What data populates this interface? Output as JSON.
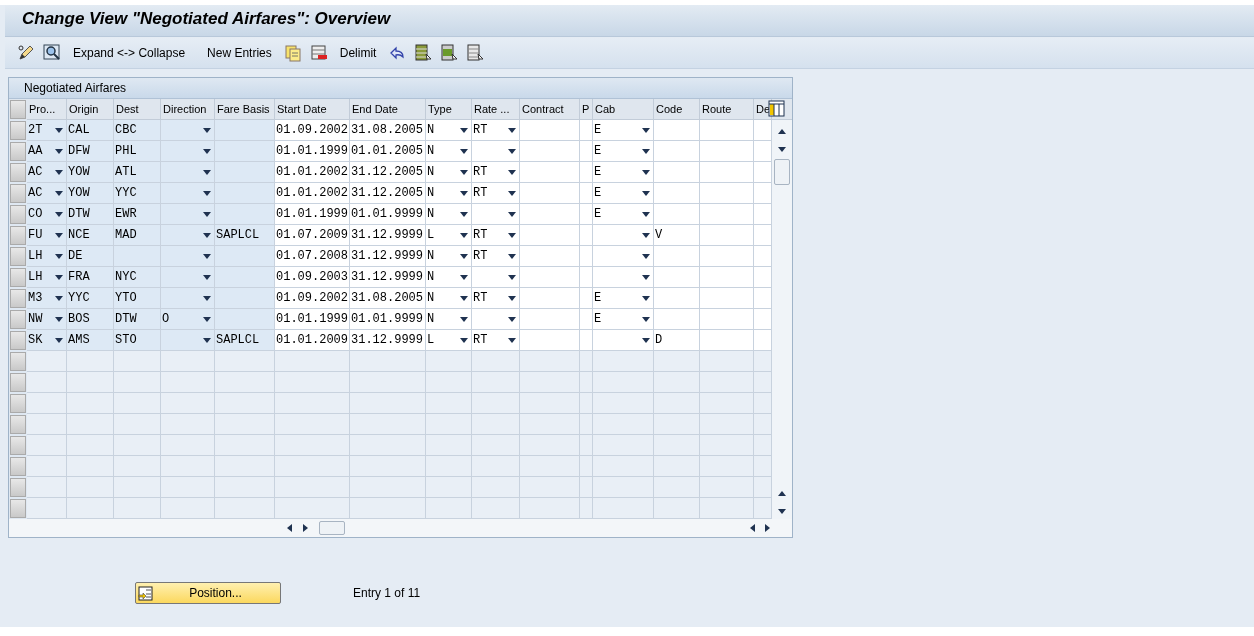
{
  "window": {
    "title": "Change View \"Negotiated Airfares\": Overview"
  },
  "toolbar": {
    "buttons": [
      "Expand <-> Collapse",
      "New Entries",
      "Delimit"
    ]
  },
  "table": {
    "title": "Negotiated Airfares",
    "columns": [
      {
        "label": "Pro...",
        "kind": "keylist"
      },
      {
        "label": "Origin",
        "kind": "key"
      },
      {
        "label": "Dest",
        "kind": "key"
      },
      {
        "label": "Direction",
        "kind": "keylist"
      },
      {
        "label": "Fare Basis",
        "kind": "key"
      },
      {
        "label": "Start Date",
        "kind": "field"
      },
      {
        "label": "End Date",
        "kind": "field"
      },
      {
        "label": "Type",
        "kind": "list"
      },
      {
        "label": "Rate ...",
        "kind": "list"
      },
      {
        "label": "Contract",
        "kind": "field"
      },
      {
        "label": "P",
        "kind": "field"
      },
      {
        "label": "Cab",
        "kind": "list"
      },
      {
        "label": "Code",
        "kind": "field"
      },
      {
        "label": "Route",
        "kind": "field"
      },
      {
        "label": "De",
        "kind": "field"
      }
    ],
    "rows": [
      [
        "2T",
        "CAL",
        "CBC",
        "",
        "",
        "01.09.2002",
        "31.08.2005",
        "N",
        "RT",
        "",
        "",
        "E",
        "",
        "",
        ""
      ],
      [
        "AA",
        "DFW",
        "PHL",
        "",
        "",
        "01.01.1999",
        "01.01.2005",
        "N",
        "",
        "",
        "",
        "E",
        "",
        "",
        ""
      ],
      [
        "AC",
        "YOW",
        "ATL",
        "",
        "",
        "01.01.2002",
        "31.12.2005",
        "N",
        "RT",
        "",
        "",
        "E",
        "",
        "",
        ""
      ],
      [
        "AC",
        "YOW",
        "YYC",
        "",
        "",
        "01.01.2002",
        "31.12.2005",
        "N",
        "RT",
        "",
        "",
        "E",
        "",
        "",
        ""
      ],
      [
        "CO",
        "DTW",
        "EWR",
        "",
        "",
        "01.01.1999",
        "01.01.9999",
        "N",
        "",
        "",
        "",
        "E",
        "",
        "",
        ""
      ],
      [
        "FU",
        "NCE",
        "MAD",
        "",
        "SAPLCL",
        "01.07.2009",
        "31.12.9999",
        "L",
        "RT",
        "",
        "",
        "",
        "V",
        "",
        ""
      ],
      [
        "LH",
        "DE",
        "",
        "",
        "",
        "01.07.2008",
        "31.12.9999",
        "N",
        "RT",
        "",
        "",
        "",
        "",
        "",
        ""
      ],
      [
        "LH",
        "FRA",
        "NYC",
        "",
        "",
        "01.09.2003",
        "31.12.9999",
        "N",
        "",
        "",
        "",
        "",
        "",
        "",
        ""
      ],
      [
        "M3",
        "YYC",
        "YTO",
        "",
        "",
        "01.09.2002",
        "31.08.2005",
        "N",
        "RT",
        "",
        "",
        "E",
        "",
        "",
        ""
      ],
      [
        "NW",
        "BOS",
        "DTW",
        "O",
        "",
        "01.01.1999",
        "01.01.9999",
        "N",
        "",
        "",
        "",
        "E",
        "",
        "",
        ""
      ],
      [
        "SK",
        "AMS",
        "STO",
        "",
        "SAPLCL",
        "01.01.2009",
        "31.12.9999",
        "L",
        "RT",
        "",
        "",
        "",
        "D",
        "",
        ""
      ]
    ]
  },
  "footer": {
    "position_button": "Position...",
    "entry_info": "Entry 1 of 11"
  }
}
